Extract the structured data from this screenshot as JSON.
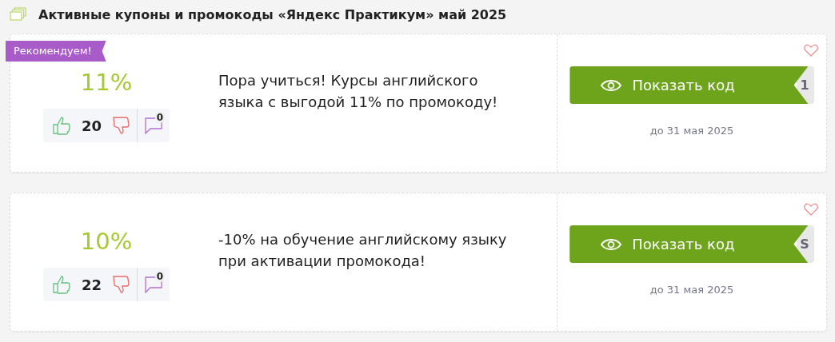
{
  "heading": "Активные купоны и промокоды «Яндекс Практикум» май 2025",
  "coupons": [
    {
      "badge": "Рекомендуем!",
      "discount": "11%",
      "likes": "20",
      "comments": "0",
      "description": "Пора учиться! Курсы английского языка с выгодой 11% по промокоду!",
      "button": "Показать код",
      "code_peek": "1",
      "expires": "до 31 мая 2025"
    },
    {
      "discount": "10%",
      "likes": "22",
      "comments": "0",
      "description": "-10% на обучение английскому языку при активации промокода!",
      "button": "Показать код",
      "code_peek": "S",
      "expires": "до 31 мая 2025"
    }
  ]
}
